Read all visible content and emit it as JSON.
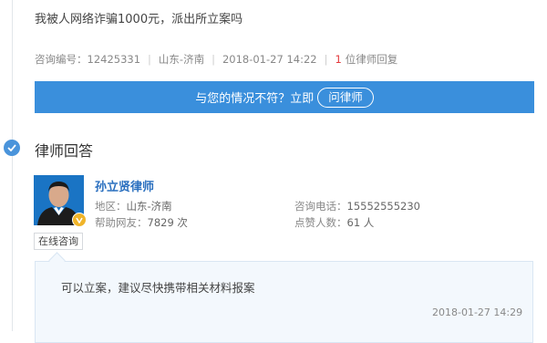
{
  "question": {
    "text": "我被人网络诈骗1000元，派出所立案吗",
    "meta": {
      "id_label": "咨询编号：12425331",
      "location": "山东-济南",
      "datetime": "2018-01-27 14:22",
      "reply_count": "1",
      "reply_suffix": "位律师回复"
    }
  },
  "ask_bar": {
    "prompt": "与您的情况不符？立即",
    "button_label": "问律师"
  },
  "section": {
    "title": "律师回答"
  },
  "lawyer": {
    "name": "孙立贤律师",
    "online_label": "在线咨询",
    "region_label": "地区：",
    "region_value": "山东-济南",
    "helped_label": "帮助网友：",
    "helped_value": "7829 次",
    "phone_label": "咨询电话：",
    "phone_value": "15552555230",
    "likes_label": "点赞人数：",
    "likes_value": "61 人"
  },
  "answer": {
    "text": "可以立案，建议尽快携带相关材料报案",
    "datetime": "2018-01-27 14:29"
  },
  "colors": {
    "accent": "#3a8fdc",
    "name_link": "#2a6fbf",
    "reply_count": "#e4393c",
    "badge": "#f0b429"
  }
}
